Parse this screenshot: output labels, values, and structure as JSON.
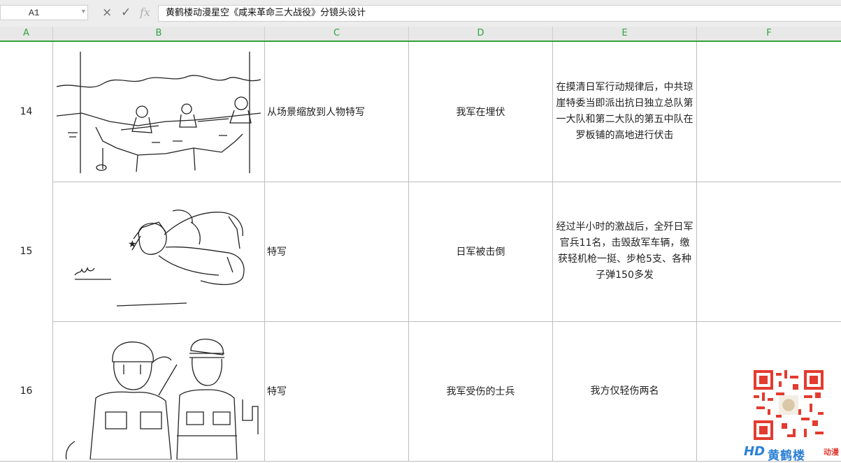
{
  "formula_bar": {
    "cell_ref": "A1",
    "content": "黄鹤楼动漫星空《咸来革命三大战役》分镜头设计",
    "cancel_icon": "×",
    "confirm_icon": "✓",
    "fx_label": "fx"
  },
  "columns": [
    "A",
    "B",
    "C",
    "D",
    "E",
    "F"
  ],
  "rows": [
    {
      "num": "14",
      "shot": "从场景缩放到人物特写",
      "action": "我军在埋伏",
      "description": "在摸清日军行动规律后，中共琼崖特委当即派出抗日独立总队第一大队和第二大队的第五中队在罗板铺的高地进行伏击",
      "sketch": "soldiers-ambush-trench"
    },
    {
      "num": "15",
      "shot": "特写",
      "action": "日军被击倒",
      "description": "经过半小时的激战后，全歼日军官兵11名，击毁敌军车辆，缴获轻机枪一挺、步枪5支、各种子弹150多发",
      "sketch": "fallen-soldier"
    },
    {
      "num": "16",
      "shot": "特写",
      "action": "我军受伤的士兵",
      "description": "我方仅轻伤两名",
      "sketch": "saluting-soldiers"
    }
  ],
  "watermark": {
    "logo_mark": "HD",
    "logo_text": "黄鹤楼",
    "logo_sub": "动漫",
    "qr_icon": "qr-code-icon"
  },
  "colors": {
    "header_accent": "#2fa33d",
    "logo_blue": "#2a7fd6",
    "qr_red": "#e33b2f"
  }
}
